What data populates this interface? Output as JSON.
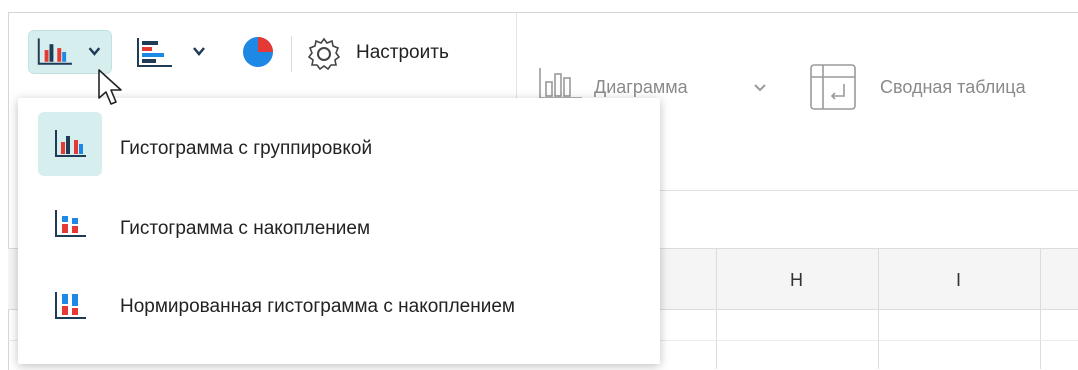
{
  "toolbar": {
    "settings_label": "Настроить",
    "ribbon_chart_label": "Диаграмма",
    "ribbon_pivot_label": "Сводная таблица",
    "colors": {
      "bar_red": "#e53935",
      "bar_blue": "#1e88e5",
      "axis": "#1f3c57",
      "active_bg": "#d6eeee"
    }
  },
  "chart_type_menu": {
    "items": [
      {
        "label": "Гистограмма с группировкой",
        "icon": "clustered-column-icon",
        "selected": true
      },
      {
        "label": "Гистограмма с накоплением",
        "icon": "stacked-column-icon",
        "selected": false
      },
      {
        "label": "Нормированная гистограмма с накоплением",
        "icon": "percent-stacked-column-icon",
        "selected": false
      }
    ]
  },
  "grid": {
    "columns": [
      "H",
      "I"
    ]
  }
}
